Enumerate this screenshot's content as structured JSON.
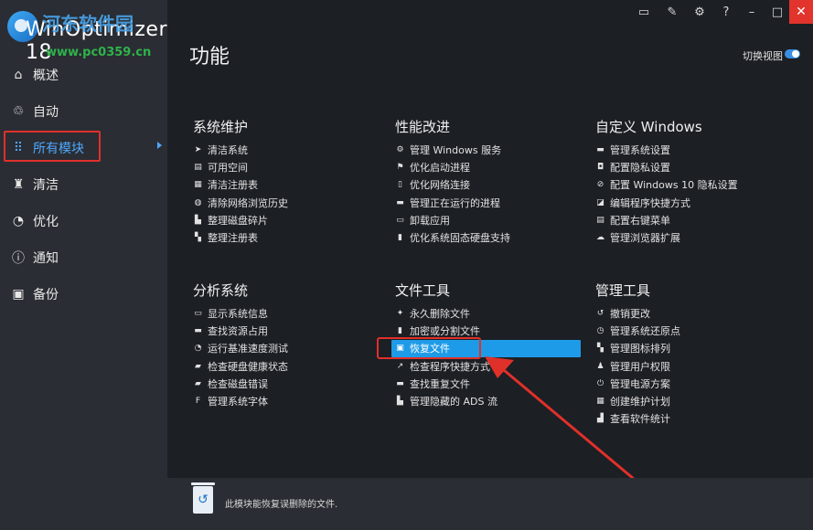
{
  "app": {
    "title": "WinOptimizer 18",
    "watermark_site": "www.pc0359.cn",
    "watermark_text": "河东软件园"
  },
  "titlebar": {
    "icons": [
      "chat-icon",
      "edit-icon",
      "gear-icon",
      "help-icon",
      "minimize-icon",
      "maximize-icon",
      "close-icon"
    ],
    "help_glyph": "?"
  },
  "sidebar": {
    "items": [
      {
        "label": "概述",
        "icon": "home-icon"
      },
      {
        "label": "自动",
        "icon": "automatic-icon"
      },
      {
        "label": "所有模块",
        "icon": "grid-icon",
        "active": true
      },
      {
        "label": "清洁",
        "icon": "broom-icon"
      },
      {
        "label": "优化",
        "icon": "gauge-icon"
      },
      {
        "label": "通知",
        "icon": "info-icon"
      },
      {
        "label": "备份",
        "icon": "backup-icon"
      }
    ]
  },
  "main": {
    "title": "功能",
    "switch_view_label": "切换视图",
    "groups": [
      {
        "title": "系统维护",
        "items": [
          "清洁系统",
          "可用空间",
          "清洁注册表",
          "清除网络浏览历史",
          "整理磁盘碎片",
          "整理注册表"
        ]
      },
      {
        "title": "性能改进",
        "items": [
          "管理 Windows 服务",
          "优化启动进程",
          "优化网络连接",
          "管理正在运行的进程",
          "卸载应用",
          "优化系统固态硬盘支持"
        ]
      },
      {
        "title": "自定义 Windows",
        "items": [
          "管理系统设置",
          "配置隐私设置",
          "配置 Windows 10 隐私设置",
          "编辑程序快捷方式",
          "配置右键菜单",
          "管理浏览器扩展"
        ]
      },
      {
        "title": "分析系统",
        "items": [
          "显示系统信息",
          "查找资源占用",
          "运行基准速度测试",
          "检查硬盘健康状态",
          "检查磁盘错误",
          "管理系统字体"
        ]
      },
      {
        "title": "文件工具",
        "items": [
          "永久删除文件",
          "加密或分割文件",
          "恢复文件",
          "检查程序快捷方式",
          "查找重复文件",
          "管理隐藏的 ADS 流"
        ],
        "selected_index": 2
      },
      {
        "title": "管理工具",
        "items": [
          "撤销更改",
          "管理系统还原点",
          "管理图标排列",
          "管理用户权限",
          "管理电源方案",
          "创建维护计划",
          "查看软件统计"
        ]
      }
    ]
  },
  "footer": {
    "message": "此模块能恢复误删除的文件."
  },
  "colors": {
    "accent": "#1e9be8",
    "annotation": "#e0302a",
    "background": "#1c1f24",
    "sidebar": "#2a2d33"
  }
}
